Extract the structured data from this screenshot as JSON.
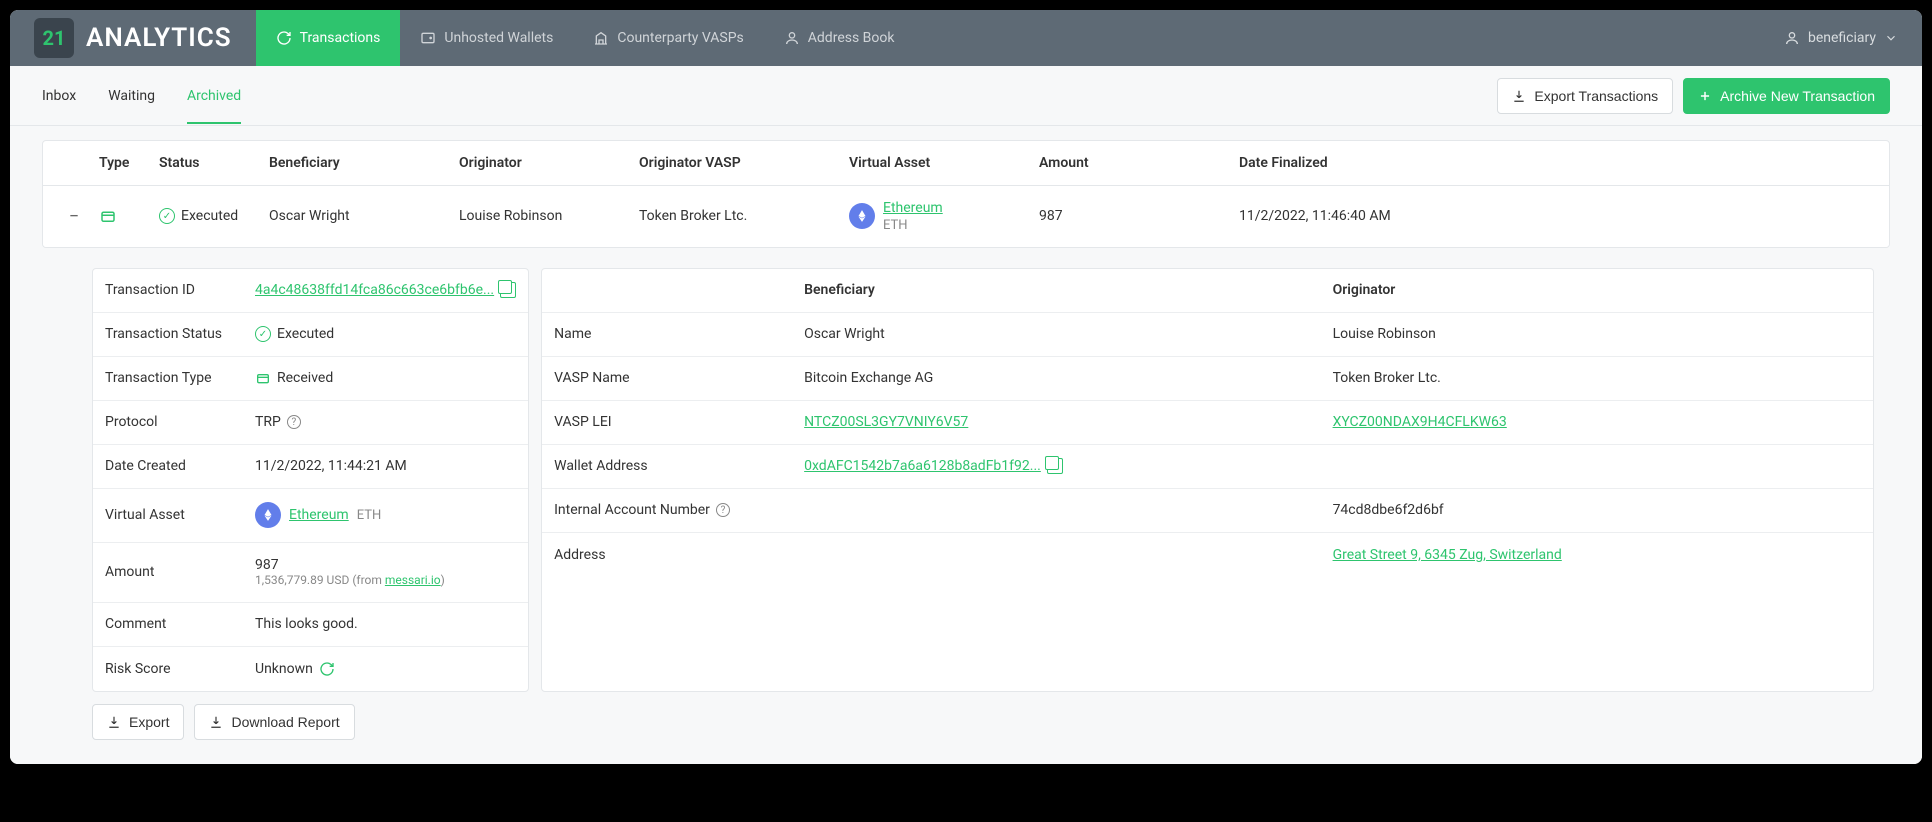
{
  "brand": {
    "short": "21",
    "name": "ANALYTICS"
  },
  "nav": {
    "items": [
      {
        "label": "Transactions"
      },
      {
        "label": "Unhosted Wallets"
      },
      {
        "label": "Counterparty VASPs"
      },
      {
        "label": "Address Book"
      }
    ]
  },
  "user": {
    "label": "beneficiary"
  },
  "subtabs": {
    "items": [
      {
        "label": "Inbox"
      },
      {
        "label": "Waiting"
      },
      {
        "label": "Archived"
      }
    ]
  },
  "actions": {
    "export_transactions": "Export Transactions",
    "archive_new": "Archive New Transaction"
  },
  "table": {
    "headers": {
      "type": "Type",
      "status": "Status",
      "beneficiary": "Beneficiary",
      "originator": "Originator",
      "originator_vasp": "Originator VASP",
      "virtual_asset": "Virtual Asset",
      "amount": "Amount",
      "date_finalized": "Date Finalized"
    },
    "rows": [
      {
        "status": "Executed",
        "beneficiary": "Oscar Wright",
        "originator": "Louise Robinson",
        "originator_vasp": "Token Broker Ltc.",
        "asset_name": "Ethereum",
        "asset_symbol": "ETH",
        "amount": "987",
        "date_finalized": "11/2/2022, 11:46:40 AM"
      }
    ]
  },
  "details": {
    "left": {
      "transaction_id_label": "Transaction ID",
      "transaction_id": "4a4c48638ffd14fca86c663ce6bfb6e...",
      "transaction_status_label": "Transaction Status",
      "transaction_status": "Executed",
      "transaction_type_label": "Transaction Type",
      "transaction_type": "Received",
      "protocol_label": "Protocol",
      "protocol": "TRP",
      "date_created_label": "Date Created",
      "date_created": "11/2/2022, 11:44:21 AM",
      "virtual_asset_label": "Virtual Asset",
      "virtual_asset_name": "Ethereum",
      "virtual_asset_symbol": "ETH",
      "amount_label": "Amount",
      "amount": "987",
      "amount_usd": "1,536,779.89 USD (from ",
      "amount_usd_source": "messari.io",
      "amount_usd_suffix": ")",
      "comment_label": "Comment",
      "comment": "This looks good.",
      "risk_score_label": "Risk Score",
      "risk_score": "Unknown"
    },
    "right": {
      "header_beneficiary": "Beneficiary",
      "header_originator": "Originator",
      "name_label": "Name",
      "name_beneficiary": "Oscar Wright",
      "name_originator": "Louise Robinson",
      "vasp_name_label": "VASP Name",
      "vasp_name_beneficiary": "Bitcoin Exchange AG",
      "vasp_name_originator": "Token Broker Ltc.",
      "vasp_lei_label": "VASP LEI",
      "vasp_lei_beneficiary": "NTCZ00SL3GY7VNIY6V57",
      "vasp_lei_originator": "XYCZ00NDAX9H4CFLKW63",
      "wallet_address_label": "Wallet Address",
      "wallet_address_beneficiary": "0xdAFC1542b7a6a6128b8adFb1f92...",
      "internal_account_label": "Internal Account Number",
      "internal_account_originator": "74cd8dbe6f2d6bf",
      "address_label": "Address",
      "address_originator": "Great Street 9, 6345 Zug, Switzerland"
    }
  },
  "footer": {
    "export": "Export",
    "download_report": "Download Report"
  }
}
